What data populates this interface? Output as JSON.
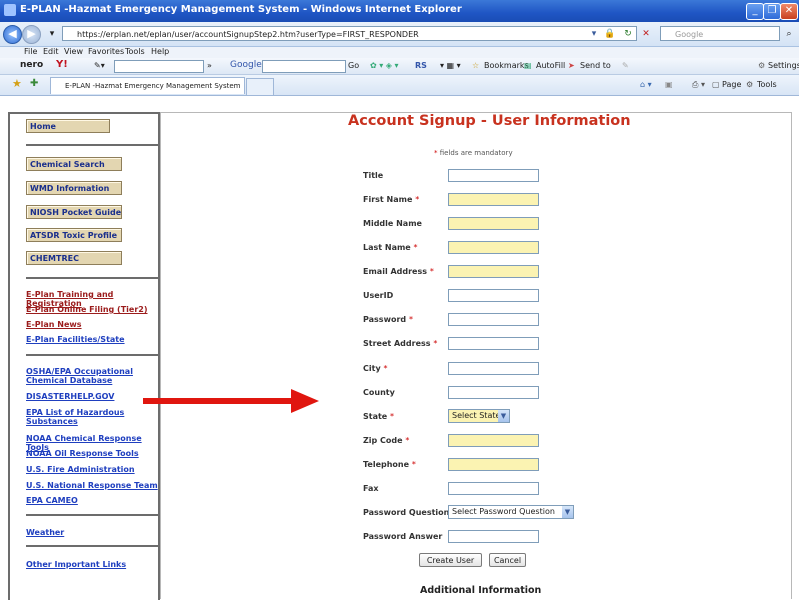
{
  "window": {
    "title": "E-PLAN -Hazmat Emergency Management System - Windows Internet Explorer"
  },
  "addressbar": {
    "url": "https://erplan.net/eplan/user/accountSignupStep2.htm?userType=FIRST_RESPONDER",
    "search_placeholder": "Google"
  },
  "menubar": {
    "items": [
      "File",
      "Edit",
      "View",
      "Favorites",
      "Tools",
      "Help"
    ]
  },
  "toolbar": {
    "nero": "nero",
    "yahoo": "Y!",
    "google": "Google",
    "go": "Go",
    "rs": "RS",
    "bookmarks": "Bookmarks",
    "autofill": "AutoFill",
    "sendto": "Send to",
    "settings": "Settings"
  },
  "tabs": {
    "active": "E-PLAN -Hazmat Emergency Management System",
    "page": "Page",
    "tools": "Tools"
  },
  "sidebar": {
    "home": "Home",
    "tools": [
      "Chemical Search",
      "WMD Information",
      "NIOSH Pocket Guide",
      "ATSDR Toxic Profile",
      "CHEMTREC"
    ],
    "eplan_links": [
      "E-Plan Training and Registration",
      "E-Plan Online Filing (Tier2)",
      "E-Plan News",
      "E-Plan Facilities/State"
    ],
    "external_links": [
      "OSHA/EPA Occupational Chemical Database",
      "DISASTERHELP.GOV",
      "EPA List of Hazardous Substances",
      "NOAA Chemical Response Tools",
      "NOAA Oil Response Tools",
      "U.S. Fire Administration",
      "U.S. National Response Team",
      "EPA CAMEO"
    ],
    "weather": "Weather",
    "other": "Other Important Links"
  },
  "form": {
    "heading": "Account Signup - User Information",
    "mandatory_note": "fields are mandatory",
    "fields": [
      {
        "label": "Title",
        "required": false,
        "value": ""
      },
      {
        "label": "First Name",
        "required": true,
        "value": ""
      },
      {
        "label": "Middle Name",
        "required": false,
        "value": ""
      },
      {
        "label": "Last Name",
        "required": true,
        "value": ""
      },
      {
        "label": "Email Address",
        "required": true,
        "value": ""
      },
      {
        "label": "UserID",
        "required": false,
        "value": ""
      },
      {
        "label": "Password",
        "required": true,
        "value": ""
      },
      {
        "label": "Street Address",
        "required": true,
        "value": ""
      },
      {
        "label": "City",
        "required": true,
        "value": ""
      },
      {
        "label": "County",
        "required": false,
        "value": ""
      },
      {
        "label": "State",
        "required": true,
        "value": "Select State"
      },
      {
        "label": "Zip Code",
        "required": true,
        "value": ""
      },
      {
        "label": "Telephone",
        "required": true,
        "value": ""
      },
      {
        "label": "Fax",
        "required": false,
        "value": ""
      },
      {
        "label": "Password Question",
        "required": false,
        "value": "Select Password Question"
      },
      {
        "label": "Password Answer",
        "required": false,
        "value": ""
      }
    ],
    "create_button": "Create User",
    "cancel_button": "Cancel",
    "additional_heading": "Additional Information"
  },
  "colors": {
    "heading": "#c8321f",
    "required_field": "#fbf3b2",
    "nav_button": "#e3d6b1",
    "link": "#1f3fbf",
    "arrow": "#e0160f"
  }
}
